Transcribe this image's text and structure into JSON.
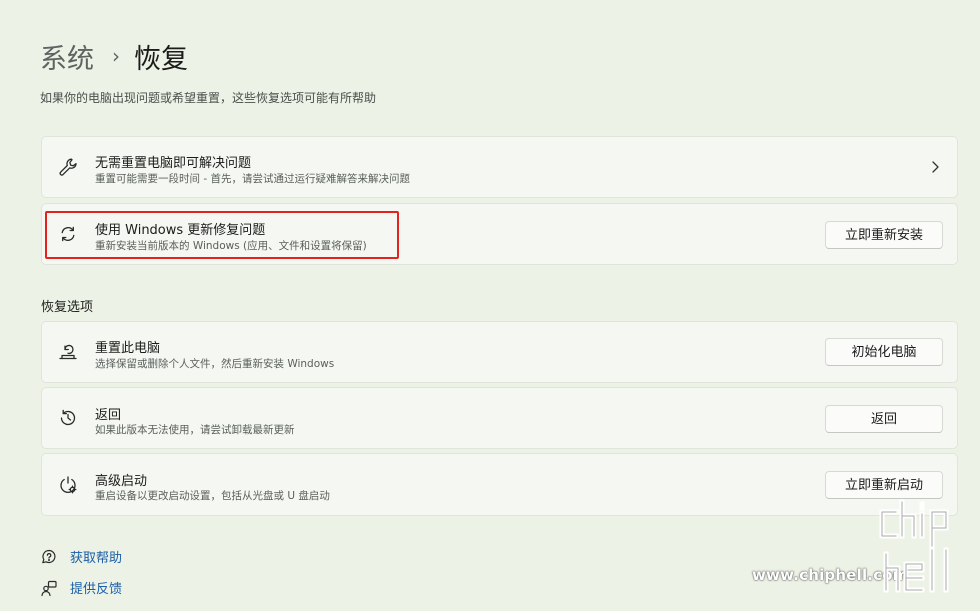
{
  "header": {
    "parent": "系统",
    "current": "恢复",
    "description": "如果你的电脑出现问题或希望重置，这些恢复选项可能有所帮助"
  },
  "cards": [
    {
      "icon": "wrench-icon",
      "title": "无需重置电脑即可解决问题",
      "subtitle": "重置可能需要一段时间 - 首先，请尝试通过运行疑难解答来解决问题",
      "action": "chevron"
    },
    {
      "icon": "refresh-icon",
      "title": "使用 Windows 更新修复问题",
      "subtitle": "重新安装当前版本的 Windows (应用、文件和设置将保留)",
      "button": "立即重新安装"
    }
  ],
  "recovery_section": {
    "heading": "恢复选项",
    "items": [
      {
        "icon": "reset-pc-icon",
        "title": "重置此电脑",
        "subtitle": "选择保留或删除个人文件，然后重新安装 Windows",
        "button": "初始化电脑"
      },
      {
        "icon": "history-icon",
        "title": "返回",
        "subtitle": "如果此版本无法使用，请尝试卸载最新更新",
        "button": "返回"
      },
      {
        "icon": "advanced-startup-icon",
        "title": "高级启动",
        "subtitle": "重启设备以更改启动设置，包括从光盘或 U 盘启动",
        "button": "立即重新启动"
      }
    ]
  },
  "footer": {
    "get_help": "获取帮助",
    "feedback": "提供反馈"
  },
  "watermark": {
    "url": "www.chiphell.com",
    "logo_text": "chip hell"
  },
  "colors": {
    "background": "#ecf2e6",
    "card": "#f5f8f2",
    "link": "#1a5ea8",
    "highlight_border": "#e4231f"
  }
}
